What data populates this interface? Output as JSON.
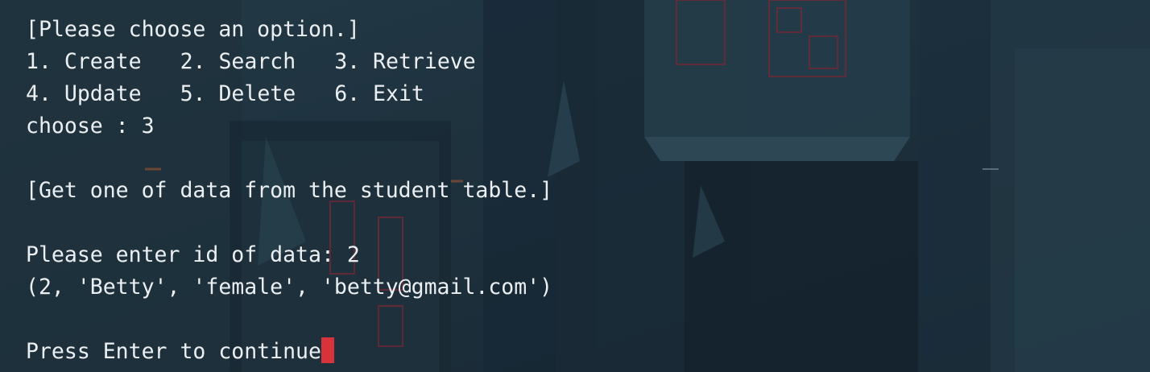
{
  "terminal": {
    "menu_title": "[Please choose an option.]",
    "menu_row1": [
      "1. Create",
      "2. Search",
      "3. Retrieve"
    ],
    "menu_row2": [
      "4. Update",
      "5. Delete",
      "6. Exit"
    ],
    "choose_prompt": "choose : 3",
    "section_title": "[Get one of data from the student table.]",
    "id_prompt": "Please enter id of data: 2",
    "result_row": "(2, 'Betty', 'female', 'betty@gmail.com')",
    "continue_prompt": "Press Enter to continue"
  },
  "colors": {
    "text": "#eceff1",
    "cursor": "#d8323a",
    "background": "#1f323f"
  }
}
